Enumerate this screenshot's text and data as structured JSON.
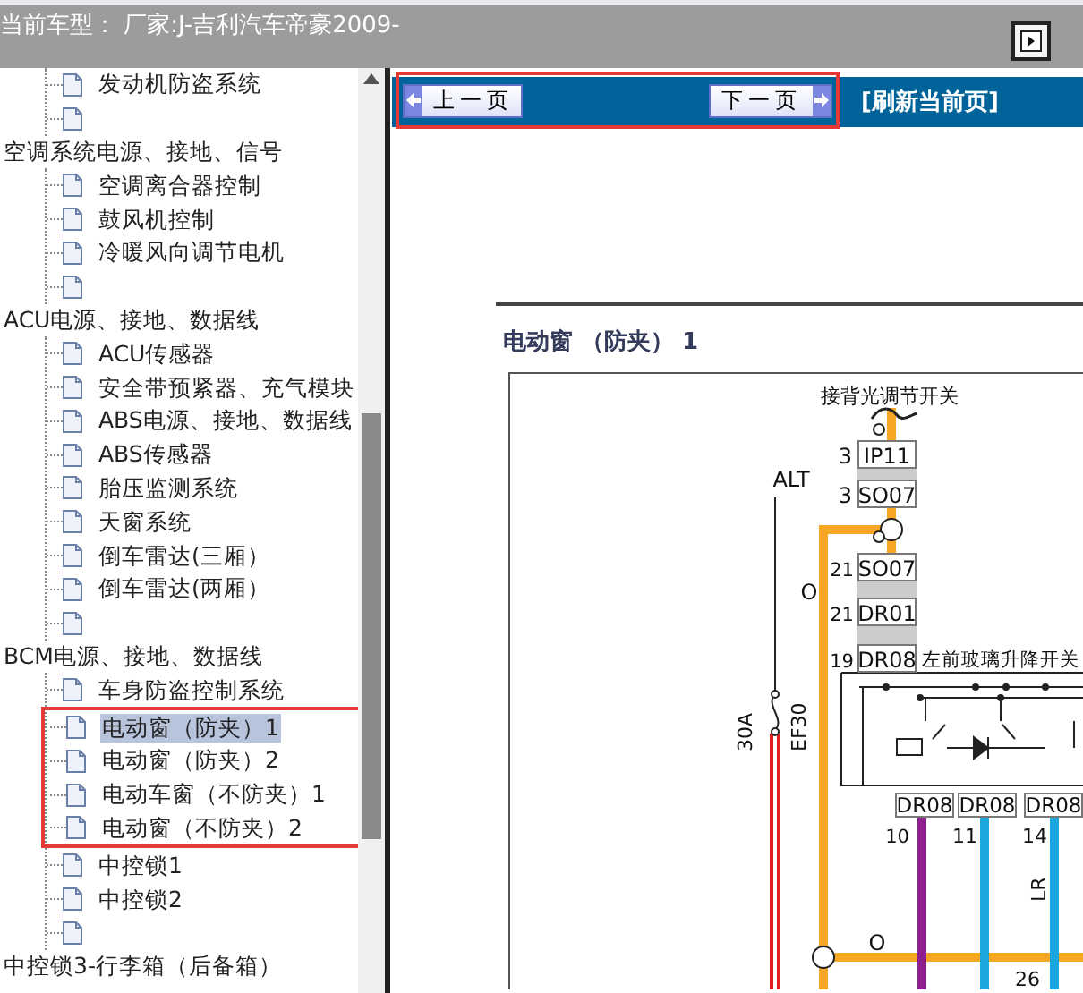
{
  "header": {
    "title": "当前车型： 厂家:J-吉利汽车帝豪2009-"
  },
  "tree": [
    {
      "items": [
        {
          "kind": "page",
          "label": "发动机防盗系统",
          "selected": false
        },
        {
          "kind": "blank",
          "selected": false
        }
      ]
    },
    {
      "label": "空调系统电源、接地、信号",
      "items": [
        {
          "kind": "page",
          "label": "空调离合器控制",
          "selected": false
        },
        {
          "kind": "page",
          "label": "鼓风机控制",
          "selected": false
        },
        {
          "kind": "page",
          "label": "冷暖风向调节电机",
          "selected": false
        },
        {
          "kind": "blank",
          "selected": false
        }
      ]
    },
    {
      "label": "ACU电源、接地、数据线",
      "items": [
        {
          "kind": "page",
          "label": "ACU传感器",
          "selected": false
        },
        {
          "kind": "page",
          "label": "安全带预紧器、充气模块",
          "selected": false
        },
        {
          "kind": "page",
          "label": "ABS电源、接地、数据线",
          "selected": false
        },
        {
          "kind": "page",
          "label": "ABS传感器",
          "selected": false
        },
        {
          "kind": "page",
          "label": "胎压监测系统",
          "selected": false
        },
        {
          "kind": "page",
          "label": "天窗系统",
          "selected": false
        },
        {
          "kind": "page",
          "label": "倒车雷达(三厢）",
          "selected": false
        },
        {
          "kind": "page",
          "label": "倒车雷达(两厢）",
          "selected": false
        },
        {
          "kind": "blank",
          "selected": false
        }
      ]
    },
    {
      "label": "BCM电源、接地、数据线",
      "items": [
        {
          "kind": "page",
          "label": "车身防盗控制系统",
          "selected": false
        },
        {
          "kind": "page",
          "label": "电动窗（防夹）1",
          "selected": true,
          "annotated": true
        },
        {
          "kind": "page",
          "label": "电动窗（防夹）2",
          "selected": false,
          "annotated": true
        },
        {
          "kind": "page",
          "label": "电动车窗（不防夹）1",
          "selected": false,
          "annotated": true
        },
        {
          "kind": "page",
          "label": "电动窗（不防夹）2",
          "selected": false,
          "annotated": true
        },
        {
          "kind": "page",
          "label": "中控锁1",
          "selected": false
        },
        {
          "kind": "page",
          "label": "中控锁2",
          "selected": false
        },
        {
          "kind": "blank",
          "selected": false
        }
      ]
    },
    {
      "label": "中控锁3-行李箱（后备箱）"
    }
  ],
  "nav": {
    "annotated": true,
    "prev": "上一页",
    "next": "下一页",
    "refresh": "[刷新当前页]"
  },
  "page": {
    "title": "电动窗 （防夹） 1",
    "labels": [
      {
        "kind": "text",
        "text": "接背光调节开关"
      },
      {
        "kind": "text",
        "text": "ALT"
      },
      {
        "kind": "text",
        "text": "3"
      },
      {
        "kind": "box",
        "text": "IP11"
      },
      {
        "kind": "text",
        "text": "3"
      },
      {
        "kind": "box",
        "text": "SO07"
      },
      {
        "kind": "text",
        "text": "21"
      },
      {
        "kind": "box",
        "text": "SO07"
      },
      {
        "kind": "text",
        "text": "21"
      },
      {
        "kind": "box",
        "text": "DR01"
      },
      {
        "kind": "text",
        "text": "19"
      },
      {
        "kind": "box",
        "text": "DR08"
      },
      {
        "kind": "text",
        "text": "左前玻璃升降开关"
      },
      {
        "kind": "text",
        "text": "O"
      },
      {
        "kind": "rotated",
        "text": "30A"
      },
      {
        "kind": "rotated",
        "text": "EF30"
      },
      {
        "kind": "box",
        "text": "DR08"
      },
      {
        "kind": "box",
        "text": "DR08"
      },
      {
        "kind": "box",
        "text": "DR08"
      },
      {
        "kind": "text",
        "text": "10"
      },
      {
        "kind": "text",
        "text": "11"
      },
      {
        "kind": "text",
        "text": "14"
      },
      {
        "kind": "rotated",
        "text": "LR"
      },
      {
        "kind": "text",
        "text": "O"
      },
      {
        "kind": "text",
        "text": "26"
      }
    ]
  }
}
